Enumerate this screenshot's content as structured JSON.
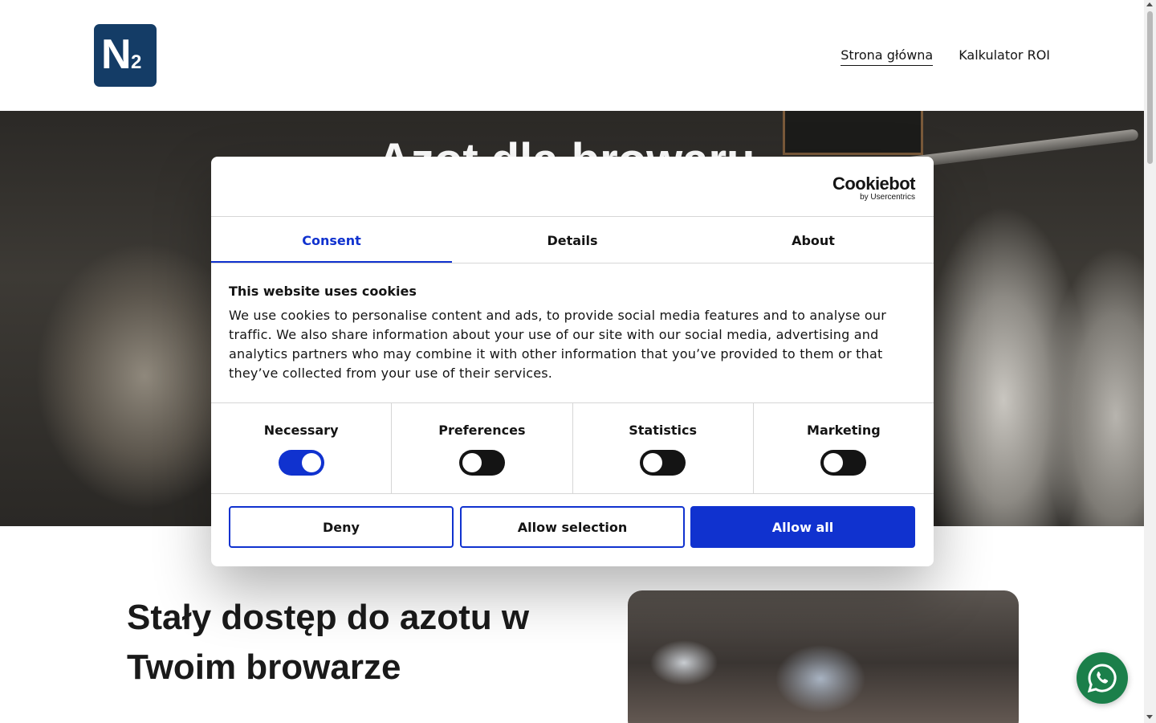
{
  "header": {
    "logo_main": "N",
    "logo_sub": "2",
    "nav": [
      {
        "label": "Strona główna"
      },
      {
        "label": "Kalkulator ROI"
      }
    ]
  },
  "hero": {
    "title": "Azot dla browaru"
  },
  "section": {
    "title": "Stały dostęp do azotu w Twoim browarze"
  },
  "cookie": {
    "brand": "Cookiebot",
    "brand_sub": "by Usercentrics",
    "tabs": [
      {
        "label": "Consent",
        "active": true
      },
      {
        "label": "Details",
        "active": false
      },
      {
        "label": "About",
        "active": false
      }
    ],
    "heading": "This website uses cookies",
    "body": "We use cookies to personalise content and ads, to provide social media features and to analyse our traffic. We also share information about your use of our site with our social media, advertising and analytics partners who may combine it with other information that you’ve provided to them or that they’ve collected from your use of their services.",
    "toggles": [
      {
        "label": "Necessary",
        "checked": true
      },
      {
        "label": "Preferences",
        "checked": false
      },
      {
        "label": "Statistics",
        "checked": false
      },
      {
        "label": "Marketing",
        "checked": false
      }
    ],
    "buttons": {
      "deny": "Deny",
      "allow_selection": "Allow selection",
      "allow_all": "Allow all"
    }
  },
  "colors": {
    "accent": "#1032cf",
    "logo_bg": "#143c66",
    "whatsapp": "#1b7f4a"
  },
  "icons": {
    "whatsapp": "whatsapp-icon"
  }
}
